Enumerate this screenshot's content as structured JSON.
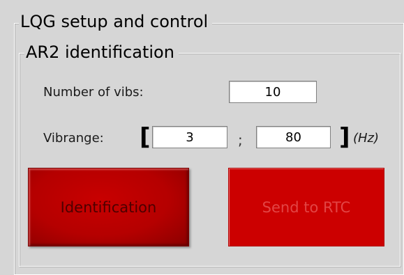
{
  "panel": {
    "title": "LQG setup and control"
  },
  "ar2": {
    "title": "AR2 identification",
    "num_vibs_label": "Number of vibs:",
    "num_vibs_value": "10",
    "vibrange_label": "Vibrange:",
    "bracket_open": "[",
    "vibrange_min": "3",
    "separator": ";",
    "vibrange_max": "80",
    "bracket_close": "]",
    "unit": "(Hz)"
  },
  "buttons": {
    "identification_label": "Identification",
    "send_label": "Send to RTC"
  },
  "colors": {
    "background": "#d6d6d6",
    "button_red": "#cc0000",
    "button_red_dark": "#8a0000"
  }
}
